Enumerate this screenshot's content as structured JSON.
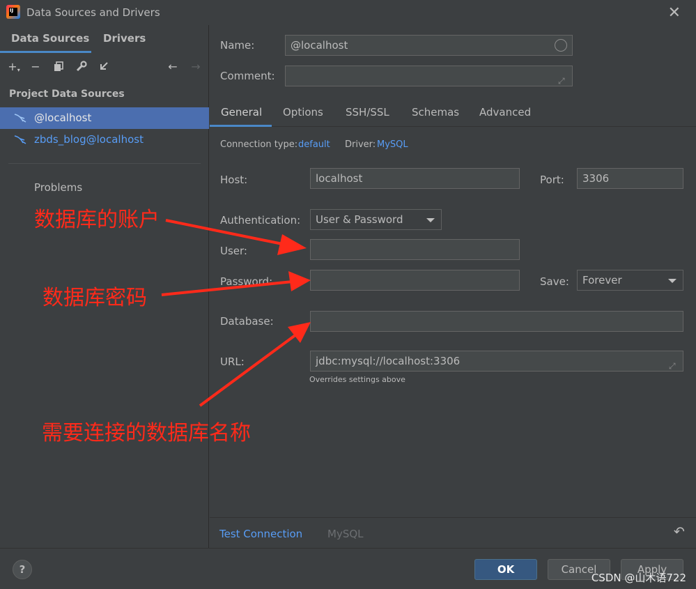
{
  "window": {
    "title": "Data Sources and Drivers"
  },
  "sidebar": {
    "tabs": [
      "Data Sources",
      "Drivers"
    ],
    "section_title": "Project Data Sources",
    "items": [
      {
        "label": "@localhost",
        "selected": true
      },
      {
        "label": "zbds_blog@localhost",
        "selected": false
      }
    ],
    "problems": "Problems"
  },
  "form": {
    "name_label": "Name:",
    "name_value": "@localhost",
    "comment_label": "Comment:",
    "comment_value": "",
    "tabs": [
      "General",
      "Options",
      "SSH/SSL",
      "Schemas",
      "Advanced"
    ],
    "connection_type_label": "Connection type:",
    "connection_type_value": "default",
    "driver_label": "Driver:",
    "driver_value": "MySQL",
    "host_label": "Host:",
    "host_value": "localhost",
    "port_label": "Port:",
    "port_value": "3306",
    "auth_label": "Authentication:",
    "auth_value": "User & Password",
    "user_label": "User:",
    "user_value": "",
    "password_label": "Password:",
    "password_value": "",
    "save_label": "Save:",
    "save_value": "Forever",
    "database_label": "Database:",
    "database_value": "",
    "url_label": "URL:",
    "url_value": "jdbc:mysql://localhost:3306",
    "url_hint": "Overrides settings above"
  },
  "bottom": {
    "test_connection": "Test Connection",
    "driver_name": "MySQL"
  },
  "footer": {
    "help": "?",
    "ok": "OK",
    "cancel": "Cancel",
    "apply": "Apply"
  },
  "annotations": {
    "account": "数据库的账户",
    "password": "数据库密码",
    "database": "需要连接的数据库名称",
    "color": "#ff2a1a"
  },
  "watermark": "CSDN @山木语722",
  "colors": {
    "accent": "#4a88c7",
    "selection": "#4b6eaf",
    "link": "#589df6",
    "ok_button": "#365880"
  }
}
